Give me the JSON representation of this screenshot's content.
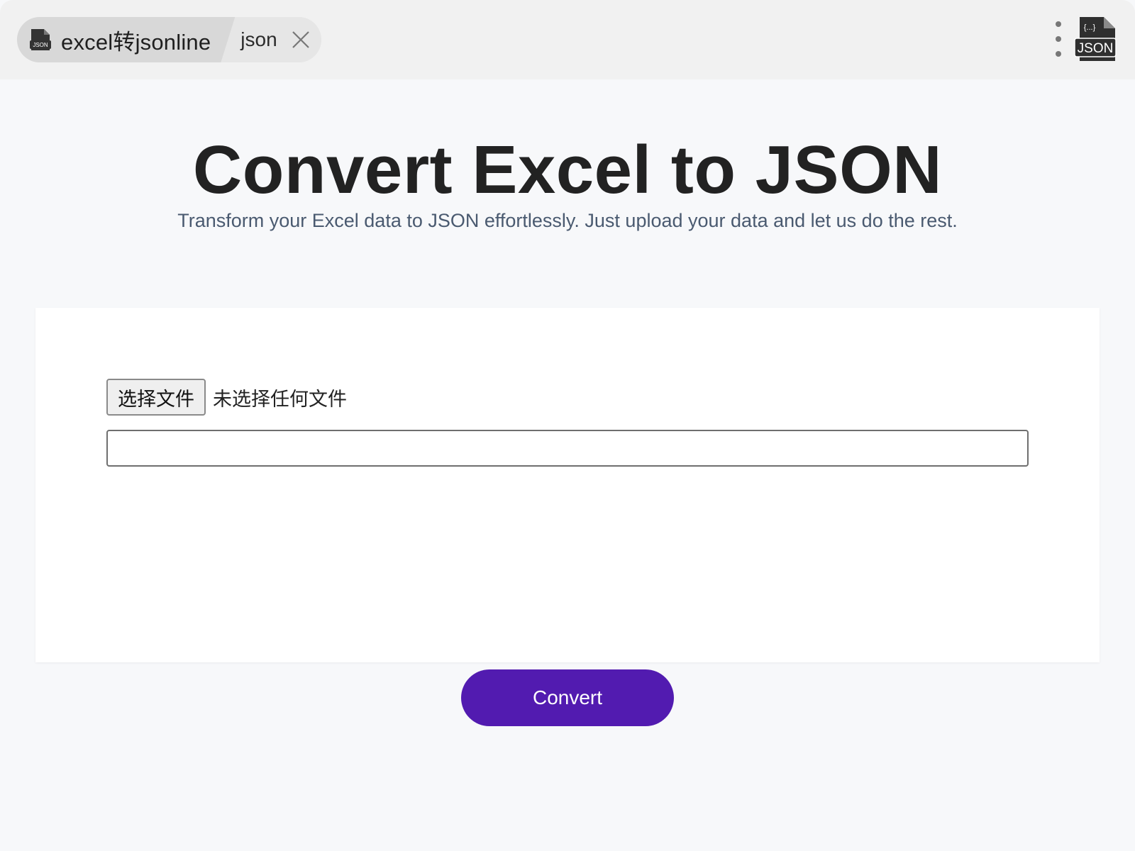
{
  "tab": {
    "title": "excel转jsonline",
    "sub_label": "json",
    "tab_icon_text": "JSON"
  },
  "header": {
    "logo_text": "JSON",
    "logo_bracket_text": "{...}"
  },
  "main": {
    "title": "Convert Excel to JSON",
    "subtitle": "Transform your Excel data to JSON effortlessly. Just upload your data and let us do the rest."
  },
  "form": {
    "file_button_label": "选择文件",
    "file_status": "未选择任何文件",
    "text_input_value": ""
  },
  "actions": {
    "convert_label": "Convert"
  },
  "colors": {
    "accent": "#521bb0",
    "title": "#222222",
    "subtitle": "#4a5a70"
  }
}
